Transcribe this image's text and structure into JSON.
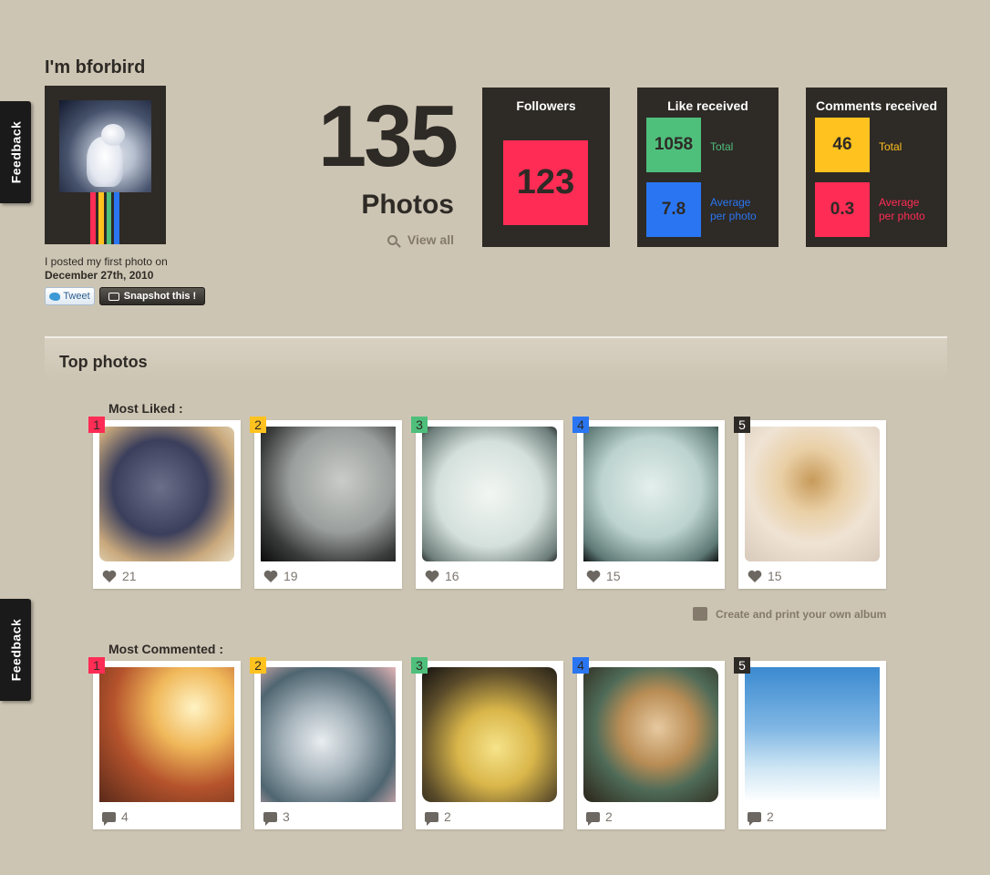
{
  "feedback": {
    "label": "Feedback"
  },
  "profile": {
    "title": "I'm bforbird",
    "first_photo_text": "I posted my first photo on",
    "first_photo_date": "December 27th, 2010",
    "tweet_label": "Tweet",
    "snapshot_label": "Snapshot this !"
  },
  "photos": {
    "count": "135",
    "label": "Photos",
    "view_all": "View all"
  },
  "followers": {
    "title": "Followers",
    "count": "123"
  },
  "likes": {
    "title": "Like received",
    "total_value": "1058",
    "total_label": "Total",
    "avg_value": "7.8",
    "avg_label_line1": "Average",
    "avg_label_line2": "per photo"
  },
  "comments": {
    "title": "Comments received",
    "total_value": "46",
    "total_label": "Total",
    "avg_value": "0.3",
    "avg_label_line1": "Average",
    "avg_label_line2": "per photo"
  },
  "top_photos": {
    "title": "Top photos",
    "most_liked_label": "Most Liked :",
    "most_commented_label": "Most Commented :",
    "most_liked": [
      {
        "rank": "1",
        "count": "21"
      },
      {
        "rank": "2",
        "count": "19"
      },
      {
        "rank": "3",
        "count": "16"
      },
      {
        "rank": "4",
        "count": "15"
      },
      {
        "rank": "5",
        "count": "15"
      }
    ],
    "most_commented": [
      {
        "rank": "1",
        "count": "4"
      },
      {
        "rank": "2",
        "count": "3"
      },
      {
        "rank": "3",
        "count": "2"
      },
      {
        "rank": "4",
        "count": "2"
      },
      {
        "rank": "5",
        "count": "2"
      }
    ],
    "album_link": "Create and print your own album"
  },
  "colors": {
    "background": "#cdc5b3",
    "panel": "#2e2a26",
    "pink": "#ff2c55",
    "green": "#4fbf7c",
    "blue": "#2a76f2",
    "yellow": "#ffc21f",
    "dark": "#2e2a26"
  },
  "icons": [
    "search-icon",
    "heart-icon",
    "comment-icon",
    "album-icon",
    "twitter-bird-icon",
    "camera-icon"
  ]
}
